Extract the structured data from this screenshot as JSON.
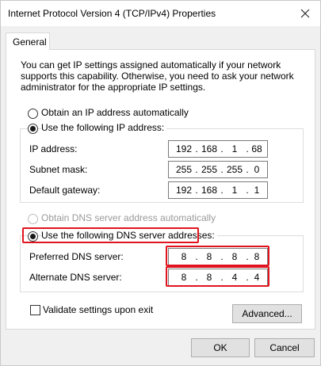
{
  "window": {
    "title": "Internet Protocol Version 4 (TCP/IPv4) Properties"
  },
  "tabs": [
    {
      "label": "General"
    }
  ],
  "intro_text": "You can get IP settings assigned automatically if your network supports this capability. Otherwise, you need to ask your network administrator for the appropriate IP settings.",
  "ip_mode": {
    "auto_label": "Obtain an IP address automatically",
    "manual_label": "Use the following IP address:",
    "selected": "manual"
  },
  "ip_fields": [
    {
      "label": "IP address:",
      "octets": [
        "192",
        "168",
        "1",
        "68"
      ]
    },
    {
      "label": "Subnet mask:",
      "octets": [
        "255",
        "255",
        "255",
        "0"
      ]
    },
    {
      "label": "Default gateway:",
      "octets": [
        "192",
        "168",
        "1",
        "1"
      ]
    }
  ],
  "dns_mode": {
    "auto_label": "Obtain DNS server address automatically",
    "manual_label": "Use the following DNS server addresses:",
    "selected": "manual"
  },
  "dns_fields": [
    {
      "label": "Preferred DNS server:",
      "octets": [
        "8",
        "8",
        "8",
        "8"
      ]
    },
    {
      "label": "Alternate DNS server:",
      "octets": [
        "8",
        "8",
        "4",
        "4"
      ]
    }
  ],
  "validate_label": "Validate settings upon exit",
  "validate_checked": false,
  "buttons": {
    "advanced": "Advanced...",
    "ok": "OK",
    "cancel": "Cancel"
  },
  "colors": {
    "highlight": "#e0141e",
    "background": "#f0f0f0"
  }
}
